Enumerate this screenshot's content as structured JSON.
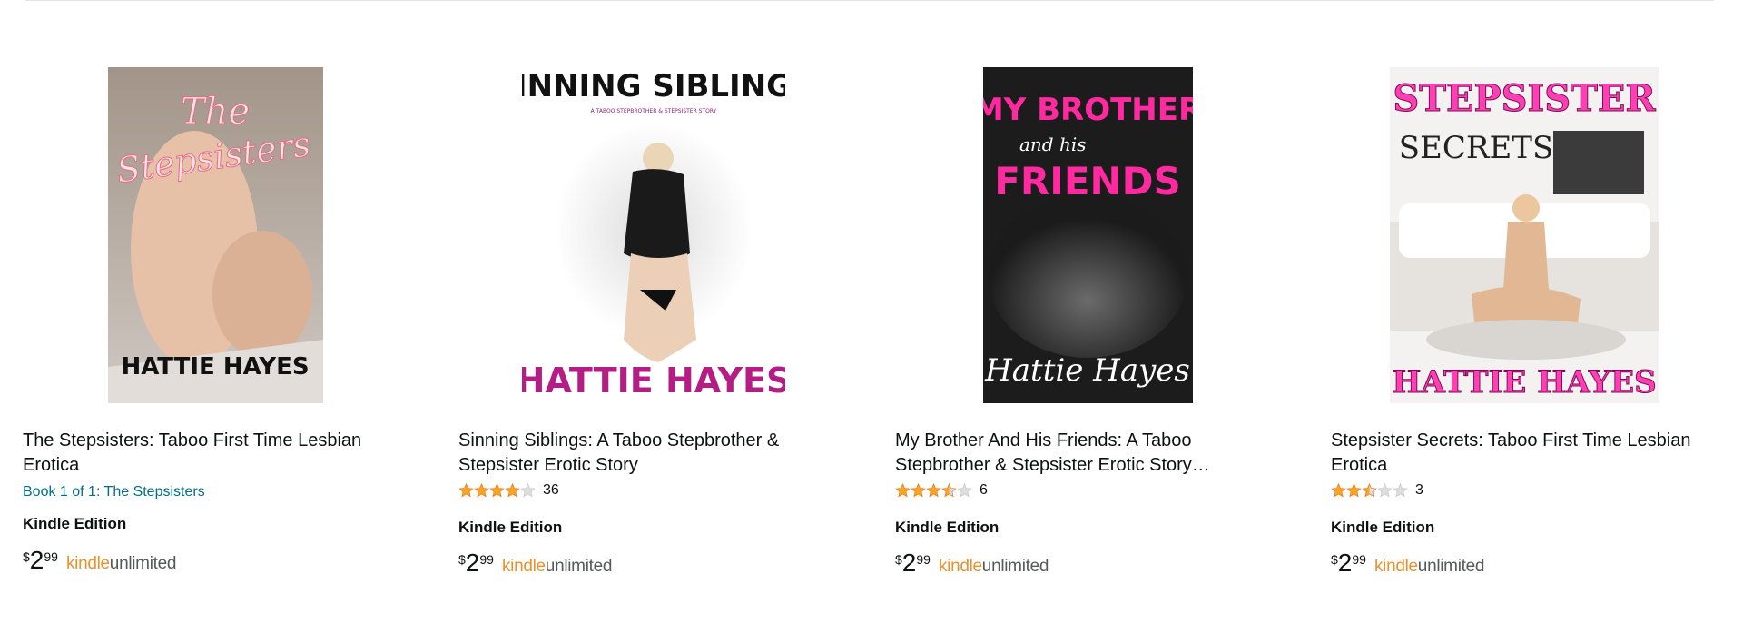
{
  "products": [
    {
      "title_line1": "The Stepsisters: Taboo First Time Lesbian",
      "title_line2": "Erotica",
      "series": "Book 1 of 1: The Stepsisters",
      "format": "Kindle Edition",
      "price": {
        "symbol": "$",
        "whole": "2",
        "fraction": "99"
      },
      "kindle_a": "kindle",
      "kindle_b": "unlimited",
      "cover": {
        "line1": "The",
        "line2": "Stepsisters",
        "author": "HATTIE HAYES"
      }
    },
    {
      "title_line1": "Sinning Siblings: A Taboo Stepbrother &",
      "title_line2": "Stepsister Erotic Story",
      "rating": 4,
      "review_count": "36",
      "format": "Kindle Edition",
      "price": {
        "symbol": "$",
        "whole": "2",
        "fraction": "99"
      },
      "kindle_a": "kindle",
      "kindle_b": "unlimited",
      "cover": {
        "line1": "SINNING SIBLINGS",
        "line2": "A TABOO STEPBROTHER & STEPSISTER STORY",
        "author": "HATTIE HAYES"
      }
    },
    {
      "title_line1": "My Brother And His Friends: A Taboo",
      "title_line2": "Stepbrother & Stepsister Erotic Story…",
      "rating": 3.5,
      "review_count": "6",
      "format": "Kindle Edition",
      "price": {
        "symbol": "$",
        "whole": "2",
        "fraction": "99"
      },
      "kindle_a": "kindle",
      "kindle_b": "unlimited",
      "cover": {
        "line1": "MY BROTHER",
        "line2": "and his",
        "line3": "FRIENDS",
        "author": "Hattie Hayes"
      }
    },
    {
      "title_line1": "Stepsister Secrets: Taboo First Time Lesbian",
      "title_line2": "Erotica",
      "rating": 2.5,
      "review_count": "3",
      "format": "Kindle Edition",
      "price": {
        "symbol": "$",
        "whole": "2",
        "fraction": "99"
      },
      "kindle_a": "kindle",
      "kindle_b": "unlimited",
      "cover": {
        "line1": "STEPSISTER",
        "line2": "SECRETS",
        "author": "HATTIE HAYES"
      }
    }
  ],
  "colors": {
    "link": "#007185",
    "star": "#ffa41c",
    "star_empty": "#dddddd",
    "kindle": "#e8912e",
    "unlimited": "#565959"
  }
}
